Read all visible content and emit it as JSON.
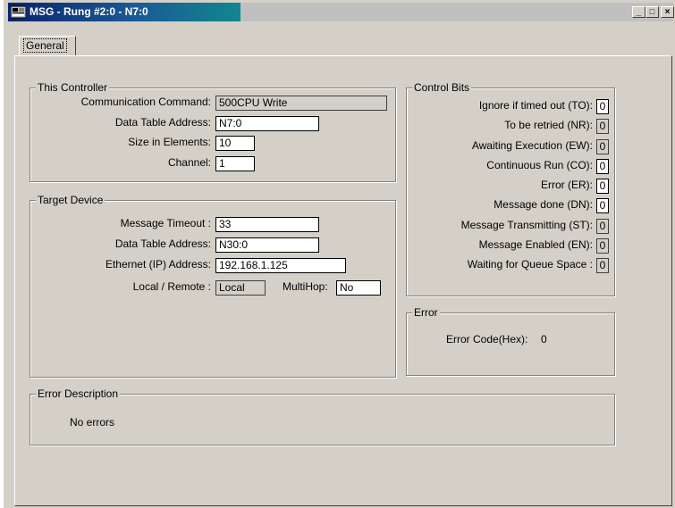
{
  "window": {
    "title": "MSG - Rung #2:0 - N7:0",
    "minimize_glyph": "_",
    "maximize_glyph": "□",
    "close_glyph": "×"
  },
  "tabs": [
    {
      "label": "General",
      "active": true
    }
  ],
  "this_controller": {
    "title": "This Controller",
    "communication_command": {
      "label": "Communication Command:",
      "value": "500CPU Write"
    },
    "data_table_address": {
      "label": "Data Table Address:",
      "value": "N7:0"
    },
    "size_in_elements": {
      "label": "Size in Elements:",
      "value": "10"
    },
    "channel": {
      "label": "Channel:",
      "value": "1"
    }
  },
  "target_device": {
    "title": "Target Device",
    "message_timeout": {
      "label": "Message Timeout :",
      "value": "33"
    },
    "data_table_address": {
      "label": "Data Table Address:",
      "value": "N30:0"
    },
    "ethernet_address": {
      "label": "Ethernet (IP) Address:",
      "value": "192.168.1.125"
    },
    "local_remote": {
      "label": "Local / Remote :",
      "value": "Local"
    },
    "multihop": {
      "label": "MultiHop:",
      "value": "No"
    }
  },
  "control_bits": {
    "title": "Control Bits",
    "items": [
      {
        "label": "Ignore if timed out (TO):",
        "value": "0",
        "editable": true
      },
      {
        "label": "To be retried (NR):",
        "value": "0",
        "editable": false
      },
      {
        "label": "Awaiting Execution (EW):",
        "value": "0",
        "editable": false
      },
      {
        "label": "Continuous Run (CO):",
        "value": "0",
        "editable": true
      },
      {
        "label": "Error (ER):",
        "value": "0",
        "editable": true
      },
      {
        "label": "Message done (DN):",
        "value": "0",
        "editable": true
      },
      {
        "label": "Message Transmitting (ST):",
        "value": "0",
        "editable": false
      },
      {
        "label": "Message Enabled (EN):",
        "value": "0",
        "editable": false
      },
      {
        "label": "Waiting for Queue Space :",
        "value": "0",
        "editable": false
      }
    ]
  },
  "error": {
    "title": "Error",
    "code_label": "Error Code(Hex):",
    "code_value": "0"
  },
  "error_description": {
    "title": "Error Description",
    "text": "No errors"
  }
}
